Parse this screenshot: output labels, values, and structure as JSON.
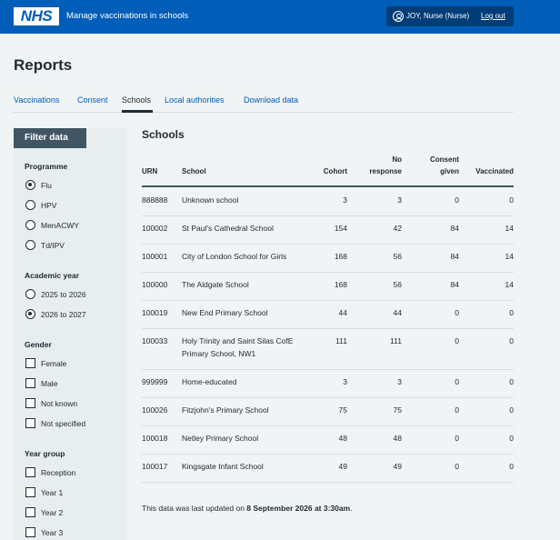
{
  "header": {
    "logo": "NHS",
    "service_name": "Manage vaccinations in schools",
    "user": "JOY, Nurse (Nurse)",
    "logout": "Log out"
  },
  "page_title": "Reports",
  "tabs": [
    {
      "label": "Vaccinations",
      "active": false
    },
    {
      "label": "Consent",
      "active": false
    },
    {
      "label": "Schools",
      "active": true
    },
    {
      "label": "Local authorities",
      "active": false
    },
    {
      "label": "Download data",
      "active": false
    }
  ],
  "filter": {
    "title": "Filter data",
    "programme": {
      "label": "Programme",
      "options": [
        {
          "label": "Flu",
          "checked": true
        },
        {
          "label": "HPV",
          "checked": false
        },
        {
          "label": "MenACWY",
          "checked": false
        },
        {
          "label": "Td/IPV",
          "checked": false
        }
      ]
    },
    "academic_year": {
      "label": "Academic year",
      "options": [
        {
          "label": "2025 to 2026",
          "checked": false
        },
        {
          "label": "2026 to 2027",
          "checked": true
        }
      ]
    },
    "gender": {
      "label": "Gender",
      "options": [
        {
          "label": "Female",
          "checked": false
        },
        {
          "label": "Male",
          "checked": false
        },
        {
          "label": "Not known",
          "checked": false
        },
        {
          "label": "Not specified",
          "checked": false
        }
      ]
    },
    "year_group": {
      "label": "Year group",
      "options": [
        {
          "label": "Reception",
          "checked": false
        },
        {
          "label": "Year 1",
          "checked": false
        },
        {
          "label": "Year 2",
          "checked": false
        },
        {
          "label": "Year 3",
          "checked": false
        }
      ]
    }
  },
  "schools": {
    "title": "Schools",
    "headers": {
      "urn": "URN",
      "school": "School",
      "cohort": "Cohort",
      "no_response_1": "No",
      "no_response_2": "response",
      "consent_1": "Consent",
      "consent_2": "given",
      "vaccinated": "Vaccinated"
    },
    "rows": [
      {
        "urn": "888888",
        "school": [
          "Unknown school"
        ],
        "cohort": "3",
        "no_response": "3",
        "consent_given": "0",
        "vaccinated": "0"
      },
      {
        "urn": "100002",
        "school": [
          "St Paul's Cathedral School"
        ],
        "cohort": "154",
        "no_response": "42",
        "consent_given": "84",
        "vaccinated": "14"
      },
      {
        "urn": "100001",
        "school": [
          "City of London School for Girls"
        ],
        "cohort": "168",
        "no_response": "56",
        "consent_given": "84",
        "vaccinated": "14"
      },
      {
        "urn": "100000",
        "school": [
          "The Aldgate School"
        ],
        "cohort": "168",
        "no_response": "56",
        "consent_given": "84",
        "vaccinated": "14"
      },
      {
        "urn": "100019",
        "school": [
          "New End Primary School"
        ],
        "cohort": "44",
        "no_response": "44",
        "consent_given": "0",
        "vaccinated": "0"
      },
      {
        "urn": "100033",
        "school": [
          "Holy Trinity and Saint Silas CofE",
          "Primary School, NW1"
        ],
        "cohort": "111",
        "no_response": "111",
        "consent_given": "0",
        "vaccinated": "0"
      },
      {
        "urn": "999999",
        "school": [
          "Home-educated"
        ],
        "cohort": "3",
        "no_response": "3",
        "consent_given": "0",
        "vaccinated": "0"
      },
      {
        "urn": "100026",
        "school": [
          "Fitzjohn's Primary School"
        ],
        "cohort": "75",
        "no_response": "75",
        "consent_given": "0",
        "vaccinated": "0"
      },
      {
        "urn": "100018",
        "school": [
          "Netley Primary School"
        ],
        "cohort": "48",
        "no_response": "48",
        "consent_given": "0",
        "vaccinated": "0"
      },
      {
        "urn": "100017",
        "school": [
          "Kingsgate Infant School"
        ],
        "cohort": "49",
        "no_response": "49",
        "consent_given": "0",
        "vaccinated": "0"
      }
    ],
    "footnote_prefix": "This data was last updated on ",
    "footnote_date": "8 September 2026 at 3:30am",
    "footnote_suffix": "."
  }
}
